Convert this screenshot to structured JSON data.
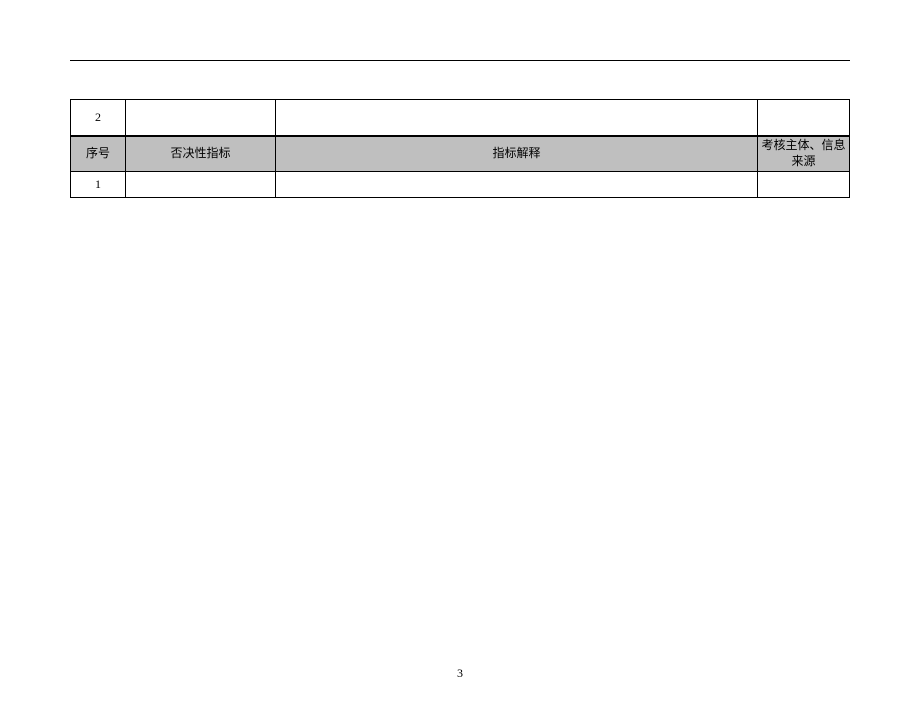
{
  "prev_row": {
    "seq": "2",
    "c2": "",
    "c3": "",
    "c4": ""
  },
  "header": {
    "seq": "序号",
    "indicator": "否决性指标",
    "explain": "指标解释",
    "source": "考核主体、信息来源"
  },
  "rows": [
    {
      "seq": "1",
      "indicator": "",
      "explain": "",
      "source": ""
    }
  ],
  "page_number": "3"
}
